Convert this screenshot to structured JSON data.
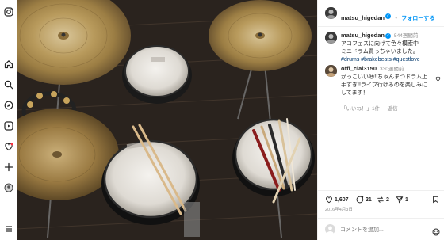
{
  "post": {
    "username": "matsu_higedan",
    "follow_label": "フォローする",
    "caption_time": "544週間前",
    "caption_line1": "アコフェスに向けて色々模索中",
    "caption_line2": "ミニドラム買っちゃいました。",
    "hashtags": "#drums #brakebeats #questlove"
  },
  "comment": {
    "username": "offi_cial3150",
    "time": "330週間前",
    "text_line1": "かっこいい😆!!ちゃんまつドラム上",
    "text_line2": "手すぎ!!ライブ行けるのを楽しみに",
    "text_line3": "してます！",
    "reply_label": "「いいね！」1件",
    "reply_btn": "返信"
  },
  "actions": {
    "likes": "1,607",
    "comments": "21",
    "shares": "2",
    "saves": "1"
  },
  "date": "2016年4月3日",
  "comment_input": {
    "placeholder": "コメントを追加..."
  },
  "colors": {
    "accent": "#0095f6",
    "hashtag": "#00376b"
  },
  "icons": [
    "instagram-icon",
    "home-icon",
    "search-icon",
    "explore-icon",
    "reels-icon",
    "messages-icon",
    "notifications-icon",
    "create-icon",
    "profile-icon",
    "more-icon",
    "heart-icon",
    "comment-icon",
    "share-icon",
    "bookmark-icon",
    "emoji-icon"
  ]
}
